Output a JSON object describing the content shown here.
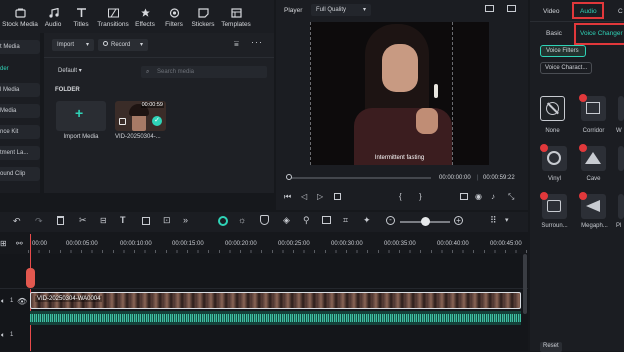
{
  "toolbar": {
    "items": [
      {
        "label": "Stock Media",
        "icon": "stock-media-icon"
      },
      {
        "label": "Audio",
        "icon": "audio-icon"
      },
      {
        "label": "Titles",
        "icon": "titles-icon"
      },
      {
        "label": "Transitions",
        "icon": "transitions-icon"
      },
      {
        "label": "Effects",
        "icon": "effects-icon"
      },
      {
        "label": "Filters",
        "icon": "filters-icon"
      },
      {
        "label": "Stickers",
        "icon": "stickers-icon"
      },
      {
        "label": "Templates",
        "icon": "templates-icon"
      }
    ]
  },
  "sidebar": {
    "items": [
      {
        "label": "t Media"
      },
      {
        "label": "der"
      },
      {
        "label": "l Media"
      },
      {
        "label": "Media"
      },
      {
        "label": "nce Kit"
      },
      {
        "label": "tment La..."
      },
      {
        "label": "ound Clip"
      }
    ]
  },
  "media": {
    "import_label": "Import",
    "record_label": "Record",
    "sort_label": "Default",
    "search_placeholder": "Search media",
    "folder_label": "FOLDER",
    "import_media_label": "Import Media",
    "clip_duration": "00:00:59",
    "clip_name": "VID-20250304-..."
  },
  "player": {
    "label": "Player",
    "quality": "Full Quality",
    "caption": "Intermittent fasting",
    "current_time": "00:00:00:00",
    "total_time": "00:00:59:22",
    "progress": 0
  },
  "right_panel": {
    "tabs": {
      "video": "Video",
      "audio": "Audio",
      "color": "C"
    },
    "subtabs": {
      "basic": "Basic",
      "voice_changer": "Voice Changer"
    },
    "filter_buttons": {
      "voice_filters": "Voice Filters",
      "voice_character": "Voice Charact..."
    },
    "items": [
      {
        "label": "None"
      },
      {
        "label": "Corridor"
      },
      {
        "label": "W"
      },
      {
        "label": "Vinyl"
      },
      {
        "label": "Cave"
      },
      {
        "label": "Surroun..."
      },
      {
        "label": "Megaph..."
      },
      {
        "label": "Pl"
      }
    ],
    "reset_label": "Reset"
  },
  "timeline": {
    "ruler_labels": [
      "00:00",
      "00:00:05:00",
      "00:00:10:00",
      "00:00:15:00",
      "00:00:20:00",
      "00:00:25:00",
      "00:00:30:00",
      "00:00:35:00",
      "00:00:40:00",
      "00:00:45:00"
    ],
    "clip_name": "VID-20250304-WA0004",
    "track_numbers": [
      "1",
      "1"
    ]
  }
}
